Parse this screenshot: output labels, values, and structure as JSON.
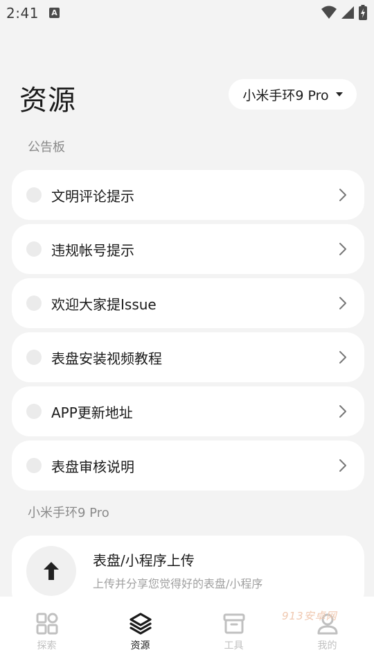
{
  "status_bar": {
    "time": "2:41",
    "notification_icon": "A"
  },
  "header": {
    "title": "资源",
    "device_selector": "小米手环9 Pro"
  },
  "notice_section": {
    "title": "公告板",
    "items": [
      {
        "label": "文明评论提示"
      },
      {
        "label": "违规帐号提示"
      },
      {
        "label": "欢迎大家提Issue"
      },
      {
        "label": "表盘安装视频教程"
      },
      {
        "label": "APP更新地址"
      },
      {
        "label": "表盘审核说明"
      }
    ]
  },
  "device_section": {
    "title": "小米手环9 Pro",
    "upload": {
      "title": "表盘/小程序上传",
      "subtitle": "上传并分享您觉得好的表盘/小程序"
    }
  },
  "bottom_nav": {
    "items": [
      {
        "label": "探索",
        "icon": "grid-icon",
        "active": false
      },
      {
        "label": "资源",
        "icon": "layers-icon",
        "active": true
      },
      {
        "label": "工具",
        "icon": "archive-box-icon",
        "active": false
      },
      {
        "label": "我的",
        "icon": "user-icon",
        "active": false
      }
    ]
  },
  "watermark": "913安卓网",
  "colors": {
    "background": "#f3f3f3",
    "card": "#ffffff",
    "muted_text": "#8a8a8a",
    "inactive_nav": "#c0c0c0"
  }
}
